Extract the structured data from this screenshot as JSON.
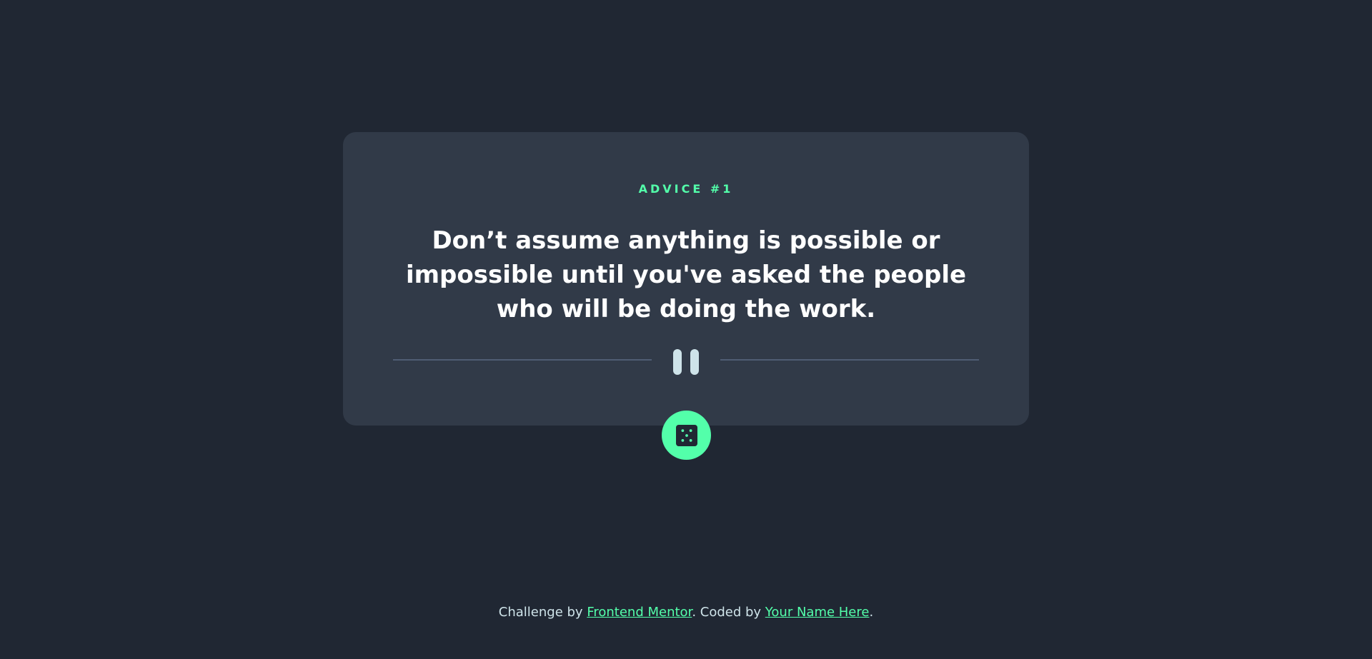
{
  "card": {
    "advice_label": "ADVICE #1",
    "quote": "Don’t assume anything is possible or impossible until you've asked the people who will be doing the work."
  },
  "dice_button": {
    "icon": "dice-icon"
  },
  "divider": {
    "icon": "pause-icon"
  },
  "footer": {
    "prefix": "Challenge by ",
    "link1": "Frontend Mentor",
    "middle": ". Coded by ",
    "link2": "Your Name Here",
    "suffix": "."
  },
  "colors": {
    "background": "#202733",
    "card": "#313a48",
    "accent": "#53ffaa",
    "text": "#ffffff",
    "muted": "#cee3e9",
    "divider": "#4f5d74"
  }
}
